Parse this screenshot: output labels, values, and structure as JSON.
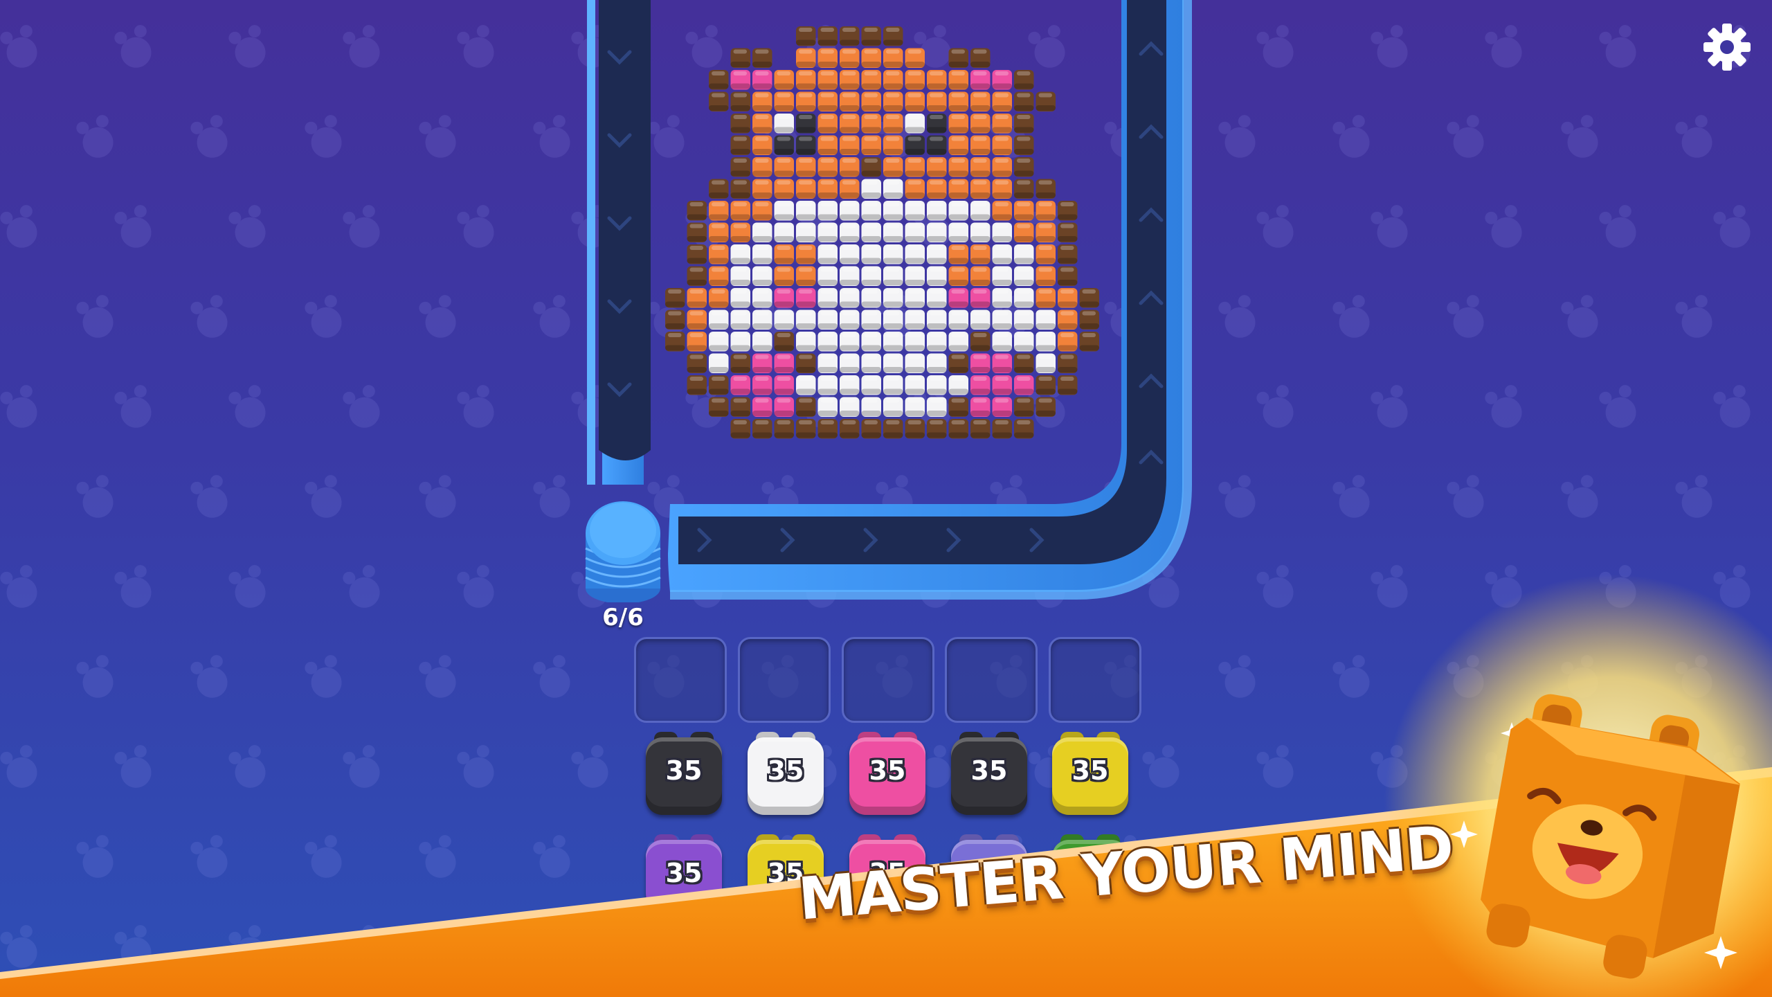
{
  "game": {
    "settings_icon": "gear-icon",
    "coin_counter": "6/6",
    "slot_count": 5,
    "colors": {
      "brown": "#6b4326",
      "orange": "#f2823a",
      "white": "#f4f4f6",
      "pink": "#ee4fa2",
      "black": "#34343a",
      "yellow": "#e6cf22",
      "purple": "#8a4fd0",
      "green": "#3e9a2e",
      "lavender": "#7a6fd6",
      "track_blue": "#3b8ff0",
      "coin_blue": "#3d9af0"
    },
    "blocks_row1": [
      {
        "color": "black",
        "label": "35"
      },
      {
        "color": "white",
        "label": "35"
      },
      {
        "color": "pink",
        "label": "35"
      },
      {
        "color": "black",
        "label": "35"
      },
      {
        "color": "yellow",
        "label": "35"
      }
    ],
    "blocks_row2": [
      {
        "color": "purple",
        "label": "35"
      },
      {
        "color": "yellow",
        "label": "35"
      },
      {
        "color": "pink",
        "label": "35"
      },
      {
        "color": "lavender",
        "label": ""
      },
      {
        "color": "green",
        "label": ""
      }
    ],
    "pixel_legend": {
      ".": "empty",
      "B": "brown",
      "O": "orange",
      "W": "white",
      "P": "pink",
      "K": "black"
    },
    "pixel_art": [
      "......BBBBB.......",
      "...BB.OOOOOO.BB...",
      "..BPPOOOOOOOOOPPB.",
      "..BBOOOOOOOOOOOOBB",
      "...BOWKOOOOWKOOOB.",
      "...BOKKOOOOKKOOOB.",
      "...BOOOOOBOOOOOOB.",
      "..BBOOOOOWWOOOOOBB",
      ".BOOOWWWWWWWWWWOOOB",
      ".BOOWWWWWWWWWWWWOOB",
      ".BOWWOOWWWWWWOOWWOB",
      ".BOWWOOWWWWWWOOWWOB",
      "BOOWWPPWWWWWWPPWWOOB",
      "BOWWWWWWWWWWWWWWWWOB",
      "BOWWWBWWWWWWWWBWWWOB",
      ".BWBPPBWWWWWWBPPBWB.",
      ".BBPPPWWWWWWWWPPPBB.",
      "..BBPPBWWWWWWBPPBB..",
      "...BBBBBBBBBBBBBB..."
    ],
    "banner": {
      "text": "MASTER YOUR MIND"
    }
  }
}
